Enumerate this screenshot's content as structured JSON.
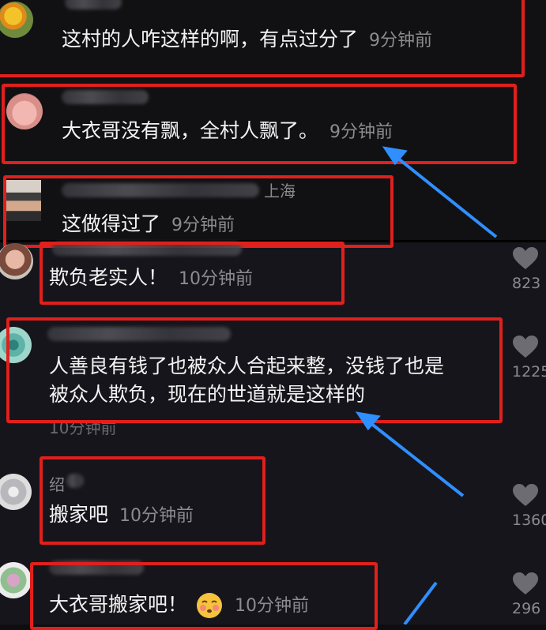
{
  "comments": [
    {
      "text": "这村的人咋这样的啊，有点过分了",
      "time": "9分钟前"
    },
    {
      "text": "大衣哥没有飘，全村人飘了。",
      "time": "9分钟前"
    },
    {
      "text": "这做得过了",
      "time": "9分钟前",
      "user_fragment": "上海"
    },
    {
      "text": "欺负老实人！",
      "time": "10分钟前",
      "likes": "823"
    },
    {
      "text_line1": "人善良有钱了也被众人合起来整，没钱了也是",
      "text_line2": "被众人欺负，现在的世道就是这样的",
      "time": "10分钟前",
      "likes": "1225"
    },
    {
      "text": "搬家吧",
      "time": "10分钟前",
      "likes": "1360",
      "user_fragment": "绍"
    },
    {
      "text": "大衣哥搬家吧！",
      "time": "10分钟前",
      "likes": "296",
      "emoji": "blushing-face-emoji"
    }
  ],
  "colors": {
    "highlight": "#e0201c",
    "arrow": "#2f8fff",
    "background": "#141418"
  }
}
